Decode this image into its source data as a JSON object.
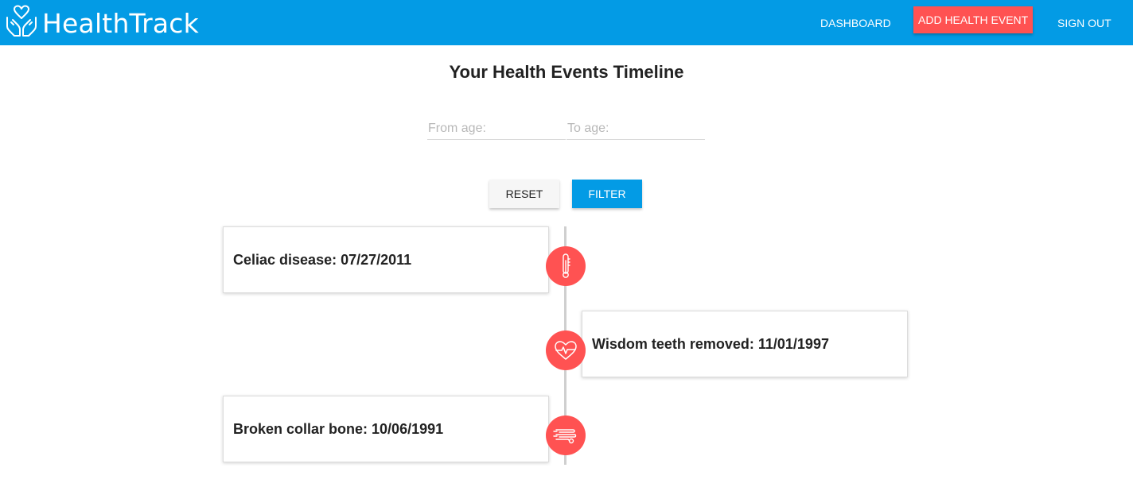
{
  "header": {
    "brand_name": "HealthTrack",
    "logo_icon": "hands-heart-icon",
    "nav": {
      "dashboard": "DASHBOARD",
      "add_event": "ADD HEALTH EVENT",
      "sign_out": "SIGN OUT"
    }
  },
  "main": {
    "title": "Your Health Events Timeline",
    "filter": {
      "from_age_placeholder": "From age:",
      "from_age_value": "",
      "to_age_placeholder": "To age:",
      "to_age_value": "",
      "reset_label": "RESET",
      "filter_label": "FILTER"
    },
    "events": [
      {
        "text": "Celiac disease: 07/27/2011",
        "icon": "thermometer-icon",
        "side": "left"
      },
      {
        "text": "Wisdom teeth removed: 11/01/1997",
        "icon": "heartbeat-icon",
        "side": "right"
      },
      {
        "text": "Broken collar bone: 10/06/1991",
        "icon": "bandage-icon",
        "side": "left"
      }
    ]
  },
  "colors": {
    "primary": "#039be5",
    "accent": "#ff5252",
    "timeline_line": "#cfcfcf"
  }
}
